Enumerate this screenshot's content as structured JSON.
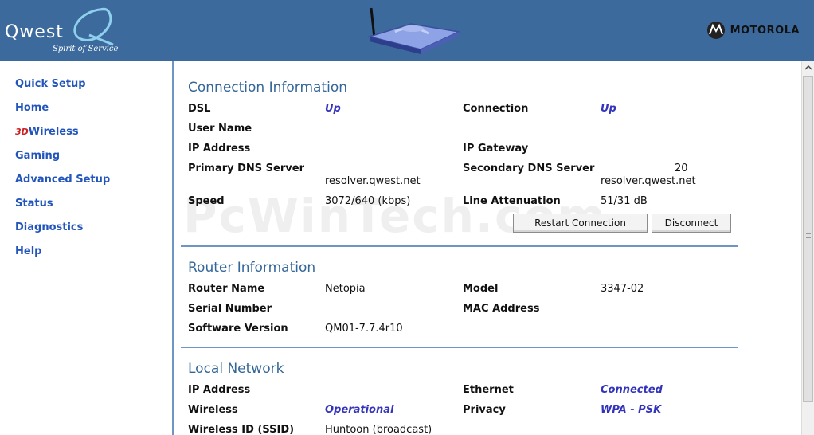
{
  "header": {
    "brand": "Qwest",
    "tagline": "Spirit of Service",
    "partner": "MOTOROLA"
  },
  "sidebar": {
    "items": [
      {
        "label": "Quick Setup"
      },
      {
        "label": "Home"
      },
      {
        "prefix": "3D",
        "label": "Wireless"
      },
      {
        "label": "Gaming"
      },
      {
        "label": "Advanced Setup"
      },
      {
        "label": "Status"
      },
      {
        "label": "Diagnostics"
      },
      {
        "label": "Help"
      }
    ]
  },
  "watermark": "PcWinTech.com",
  "connection": {
    "title": "Connection Information",
    "dsl_label": "DSL",
    "dsl_value": "Up",
    "connection_label": "Connection",
    "connection_value": "Up",
    "user_name_label": "User Name",
    "ip_address_label": "IP Address",
    "ip_gateway_label": "IP Gateway",
    "primary_dns_label": "Primary DNS Server",
    "primary_dns_value": "resolver.qwest.net",
    "secondary_dns_label": "Secondary DNS Server",
    "secondary_dns_value": "resolver.qwest.net",
    "secondary_dns_ip": "20",
    "speed_label": "Speed",
    "speed_value": "3072/640 (kbps)",
    "attenuation_label": "Line Attenuation",
    "attenuation_value": "51/31 dB",
    "restart_label": "Restart Connection",
    "disconnect_label": "Disconnect"
  },
  "router": {
    "title": "Router Information",
    "name_label": "Router Name",
    "name_value": "Netopia",
    "model_label": "Model",
    "model_value": "3347-02",
    "serial_label": "Serial Number",
    "mac_label": "MAC Address",
    "software_label": "Software Version",
    "software_value": "QM01-7.7.4r10"
  },
  "local": {
    "title": "Local Network",
    "ip_label": "IP Address",
    "ethernet_label": "Ethernet",
    "ethernet_value": "Connected",
    "wireless_label": "Wireless",
    "wireless_value": "Operational",
    "privacy_label": "Privacy",
    "privacy_value": "WPA - PSK",
    "ssid_label": "Wireless ID (SSID)",
    "ssid_value": "Huntoon (broadcast)"
  },
  "colors": {
    "header_bg": "#3d6a9c",
    "nav_link": "#2255bb",
    "section_title": "#336699",
    "status_value": "#3333bb",
    "divider": "#6d96c4"
  }
}
